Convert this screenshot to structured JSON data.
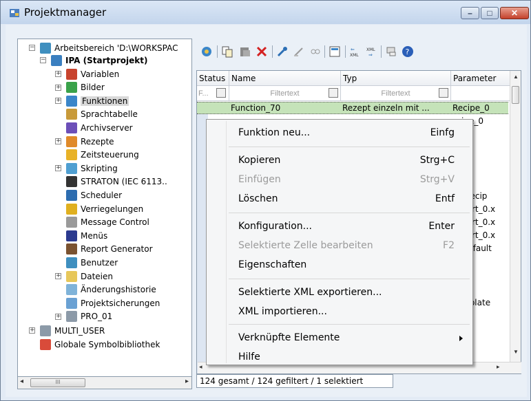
{
  "window": {
    "title": "Projektmanager"
  },
  "tree": {
    "workspace": "Arbeitsbereich 'D:\\WORKSPAC",
    "project": "IPA (Startprojekt)",
    "items": [
      {
        "label": "Variablen",
        "icon": "variables-icon",
        "color": "#c8432d"
      },
      {
        "label": "Bilder",
        "icon": "images-icon",
        "color": "#3aa24a"
      },
      {
        "label": "Funktionen",
        "icon": "functions-icon",
        "color": "#3b86c9"
      },
      {
        "label": "Sprachtabelle",
        "icon": "language-table-icon",
        "color": "#c89a3a"
      },
      {
        "label": "Archivserver",
        "icon": "archive-server-icon",
        "color": "#6c4fb8"
      },
      {
        "label": "Rezepte",
        "icon": "recipes-icon",
        "color": "#e08a2a"
      },
      {
        "label": "Zeitsteuerung",
        "icon": "clock-icon",
        "color": "#e8b228"
      },
      {
        "label": "Skripting",
        "icon": "scripting-icon",
        "color": "#4f9fd1"
      },
      {
        "label": "STRATON (IEC 6113..",
        "icon": "straton-icon",
        "color": "#333333"
      },
      {
        "label": "Scheduler",
        "icon": "scheduler-icon",
        "color": "#2d6db0"
      },
      {
        "label": "Verriegelungen",
        "icon": "interlock-icon",
        "color": "#e0b020"
      },
      {
        "label": "Message Control",
        "icon": "message-control-icon",
        "color": "#9a9a9a"
      },
      {
        "label": "Menüs",
        "icon": "menus-icon",
        "color": "#2b3a8f"
      },
      {
        "label": "Report Generator",
        "icon": "report-generator-icon",
        "color": "#7a5230"
      },
      {
        "label": "Benutzer",
        "icon": "users-icon",
        "color": "#3f8fbf"
      },
      {
        "label": "Dateien",
        "icon": "folder-icon",
        "color": "#e7c75a"
      },
      {
        "label": "Änderungshistorie",
        "icon": "history-icon",
        "color": "#7fb3d9"
      },
      {
        "label": "Projektsicherungen",
        "icon": "backup-icon",
        "color": "#6aa1d3"
      },
      {
        "label": "PRO_01",
        "icon": "project-icon",
        "color": "#8c9aa8"
      }
    ],
    "multi_user": "MULTI_USER",
    "global_library": "Globale Symbolbibliothek"
  },
  "grid": {
    "columns": [
      "Status",
      "Name",
      "Typ",
      "Parameter"
    ],
    "filter_placeholder": "Filtertext",
    "status_filter": "F...",
    "selected_row": {
      "name": "Function_70",
      "typ": "Rezept einzeln mit ...",
      "parameter": "Recipe_0"
    },
    "visible_right_cells": [
      "ipe_0",
      "[Recip",
      "port_0.x",
      "port_0.x",
      "port_0.x",
      "Default",
      "mplate"
    ]
  },
  "status_bar": "124 gesamt / 124 gefiltert / 1 selektiert",
  "context_menu": {
    "items": [
      {
        "label": "Funktion neu...",
        "shortcut": "Einfg",
        "disabled": false
      },
      {
        "label": "Kopieren",
        "shortcut": "Strg+C",
        "disabled": false
      },
      {
        "label": "Einfügen",
        "shortcut": "Strg+V",
        "disabled": true
      },
      {
        "label": "Löschen",
        "shortcut": "Entf",
        "disabled": false
      },
      {
        "label": "Konfiguration...",
        "shortcut": "Enter",
        "disabled": false
      },
      {
        "label": "Selektierte Zelle bearbeiten",
        "shortcut": "F2",
        "disabled": true
      },
      {
        "label": "Eigenschaften",
        "shortcut": "",
        "disabled": false
      },
      {
        "label": "Selektierte XML exportieren...",
        "shortcut": "",
        "disabled": false
      },
      {
        "label": "XML importieren...",
        "shortcut": "",
        "disabled": false
      },
      {
        "label": "Verknüpfte Elemente",
        "shortcut": "",
        "disabled": false
      },
      {
        "label": "Hilfe",
        "shortcut": "",
        "disabled": false
      }
    ]
  },
  "scroll_glyph": "III",
  "colors": {
    "selected_row": "#c5e3b9",
    "window_bg": "#e3ebf5"
  }
}
